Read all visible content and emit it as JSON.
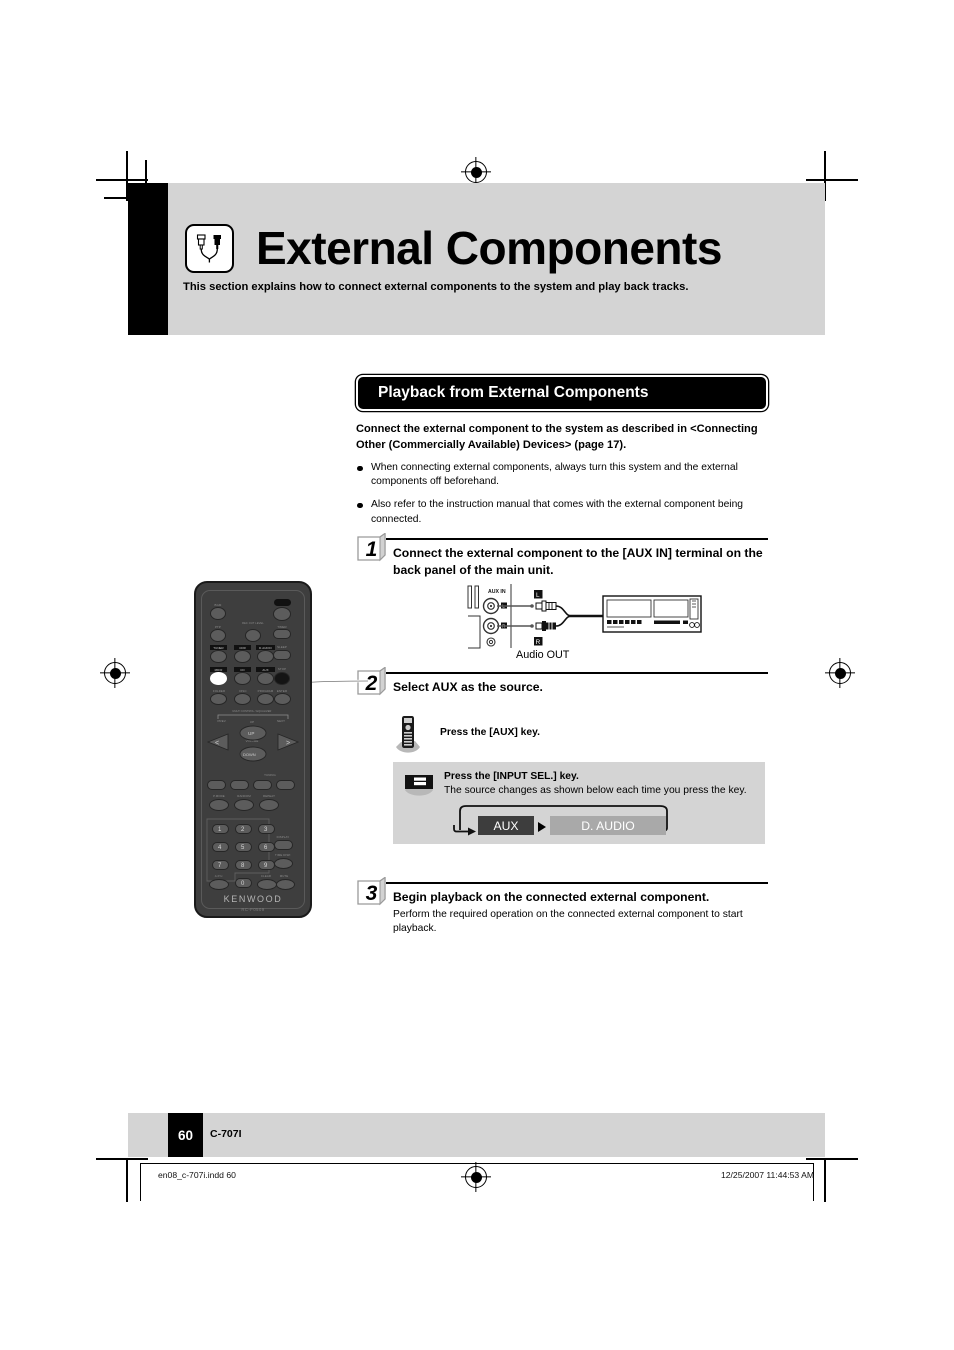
{
  "chapter": {
    "icon": "rca-plug-icon",
    "title": "External Components",
    "subtitle": "This section explains how to connect external components to the system and play back tracks."
  },
  "section": {
    "heading": "Playback from External Components",
    "lead": "Connect the external component to the system as described in <Connecting Other (Commercially Available) Devices> (page 17).",
    "bullets": [
      "When connecting external components, always turn this system and the external components off beforehand.",
      "Also refer to the instruction manual that comes with the external component being connected."
    ]
  },
  "steps": [
    {
      "number": "1",
      "title": "Connect the external component to the [AUX IN] terminal on the back panel of the main unit.",
      "diagram": {
        "terminal_label": "AUX IN",
        "channel_left": "L",
        "channel_right": "R",
        "caption": "Audio OUT"
      }
    },
    {
      "number": "2",
      "title": "Select AUX as the source.",
      "remote_hint": "Press the [AUX] key.",
      "panel": {
        "line1": "Press the [INPUT SEL.] key.",
        "line2": "The source changes as shown below each time you press the key.",
        "flow": [
          {
            "label": "AUX",
            "state": "selected",
            "color": "#3d3d3d"
          },
          {
            "label": "D. AUDIO",
            "state": "next",
            "color": "#a9a9a9"
          }
        ]
      }
    },
    {
      "number": "3",
      "title": "Begin playback on the connected external component.",
      "body": "Perform the required operation on the connected external component to start playback."
    }
  ],
  "remote": {
    "brand": "KENWOOD",
    "model": "RC-F0509",
    "labels": {
      "bgm": "BGM",
      "power": "power-icon",
      "ptp": "PTP",
      "rec_out_level": "REC OUT LEVEL",
      "timer": "TIMER",
      "tuner": "TUNER",
      "cdr": "CDR",
      "d_audio": "D.AUDIO",
      "sleep": "SLEEP",
      "mdr": "MD/R",
      "cd": "CD",
      "aux": "AUX",
      "stop": "STOP",
      "folder": "FOLDER",
      "disc": "DISC",
      "program": "PROGRAM",
      "enter": "ENTER",
      "multi_control": "MULTI CONTROL / EQUALIZER",
      "prev": "PREV.",
      "next": "NEXT",
      "up": "UP",
      "down": "DOWN",
      "volume": "VOLUME",
      "tuning": "TUNING",
      "p_mode": "P.MODE",
      "random": "RANDOM",
      "repeat": "REPEAT",
      "display": "DISPLAY",
      "dimmer": "DIMMER",
      "time_disp": "TIME DISP.",
      "a_b": "A.P.U.",
      "clear": "CLEAR",
      "mute": "MUTE",
      "keys": [
        "1",
        "2",
        "3",
        "4",
        "5",
        "6",
        "7",
        "8",
        "9",
        "0"
      ]
    }
  },
  "footer": {
    "page_number": "60",
    "model": "C-707I",
    "print_file": "en08_c-707i.indd   60",
    "print_timestamp": "12/25/2007   11:44:53 AM"
  }
}
